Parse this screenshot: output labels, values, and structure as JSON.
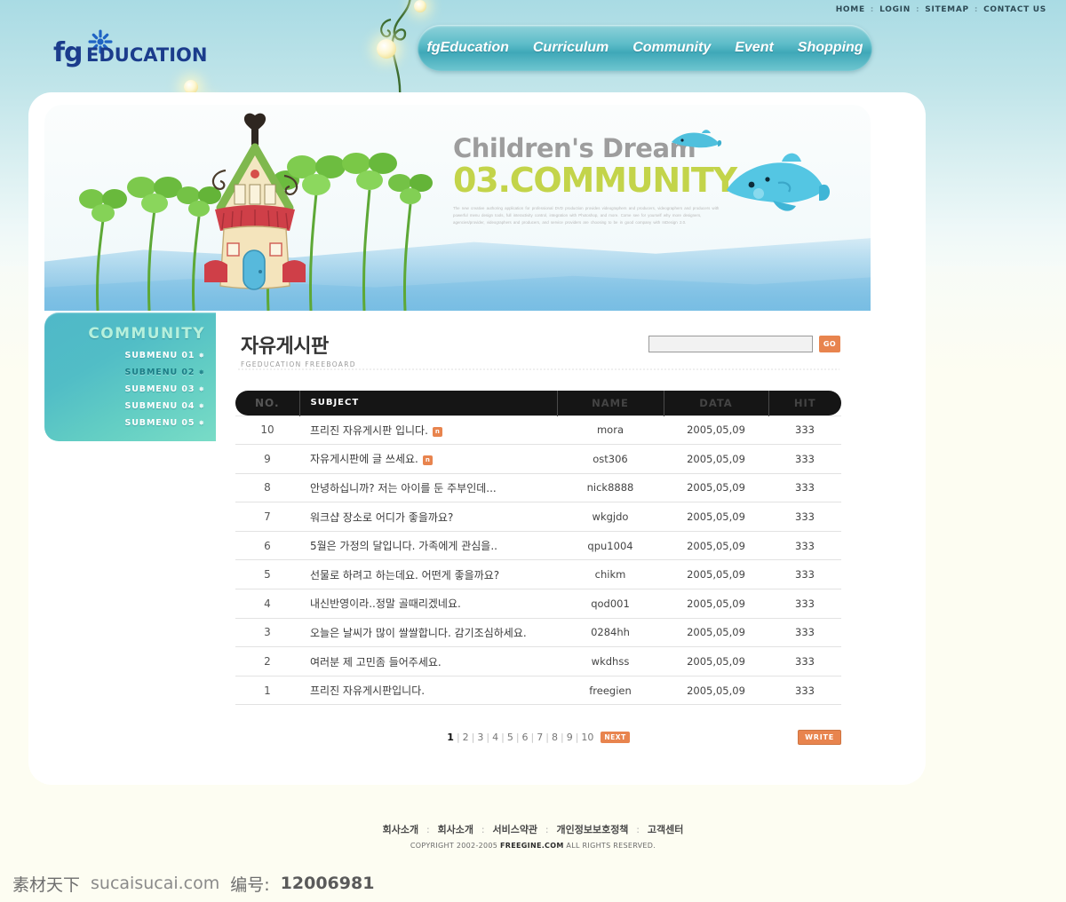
{
  "topnav": {
    "items": [
      {
        "label": "HOME"
      },
      {
        "label": "LOGIN"
      },
      {
        "label": "SITEMAP"
      },
      {
        "label": "CONTACT US"
      }
    ],
    "separator": ":"
  },
  "logo": {
    "fg": "fg",
    "edu": "EDUCATION",
    "flower_icon": "flower-icon"
  },
  "mainnav": {
    "items": [
      {
        "label": "fgEducation"
      },
      {
        "label": "Curriculum"
      },
      {
        "label": "Community"
      },
      {
        "label": "Event"
      },
      {
        "label": "Shopping"
      }
    ]
  },
  "banner": {
    "heading": "Children's Dream",
    "subheading": "03.COMMUNITY",
    "lorem": "The new creative authoring application for professional DVD production provides videographers and producers, videographers and producers with powerful menu design tools, full interactivity control, integration with Photoshop, and more. Come see for yourself why more designers, agencies/provider, videographers and producers, and service providers are choosing to be in good company with InDesign 2.0.",
    "dolphin_icon": "dolphin-icon",
    "house_icon": "fairytale-house-icon"
  },
  "sidebar": {
    "title": "COMMUNITY",
    "items": [
      {
        "label": "SUBMENU 01",
        "active": false
      },
      {
        "label": "SUBMENU 02",
        "active": true
      },
      {
        "label": "SUBMENU 03",
        "active": false
      },
      {
        "label": "SUBMENU 04",
        "active": false
      },
      {
        "label": "SUBMENU 05",
        "active": false
      }
    ],
    "bullet": "✸"
  },
  "board": {
    "title_kr": "자유게시판",
    "title_en": "FGEDUCATION FREEBOARD",
    "search": {
      "value": "",
      "placeholder": "",
      "button_label": "GO"
    },
    "columns": [
      "NO.",
      "SUBJECT",
      "NAME",
      "DATA",
      "HIT"
    ],
    "rows": [
      {
        "no": "10",
        "subject": "프리진 자유게시판 입니다.",
        "new": true,
        "name": "mora",
        "date": "2005,05,09",
        "hit": "333"
      },
      {
        "no": "9",
        "subject": "자유게시판에 글 쓰세요.",
        "new": true,
        "name": "ost306",
        "date": "2005,05,09",
        "hit": "333"
      },
      {
        "no": "8",
        "subject": "안녕하십니까? 저는 아이를 둔 주부인데...",
        "new": false,
        "name": "nick8888",
        "date": "2005,05,09",
        "hit": "333"
      },
      {
        "no": "7",
        "subject": "워크샵 장소로 어디가 좋을까요?",
        "new": false,
        "name": "wkgjdo",
        "date": "2005,05,09",
        "hit": "333"
      },
      {
        "no": "6",
        "subject": "5월은 가정의 달입니다. 가족에게 관심을..",
        "new": false,
        "name": "qpu1004",
        "date": "2005,05,09",
        "hit": "333"
      },
      {
        "no": "5",
        "subject": "선물로 하려고 하는데요. 어떤게 좋을까요?",
        "new": false,
        "name": "chikm",
        "date": "2005,05,09",
        "hit": "333"
      },
      {
        "no": "4",
        "subject": "내신반영이라..정말 골때리겠네요.",
        "new": false,
        "name": "qod001",
        "date": "2005,05,09",
        "hit": "333"
      },
      {
        "no": "3",
        "subject": "오늘은 날씨가 많이 쌀쌀합니다. 감기조심하세요.",
        "new": false,
        "name": "0284hh",
        "date": "2005,05,09",
        "hit": "333"
      },
      {
        "no": "2",
        "subject": "여러분 제 고민좀 들어주세요.",
        "new": false,
        "name": "wkdhss",
        "date": "2005,05,09",
        "hit": "333"
      },
      {
        "no": "1",
        "subject": "프리진 자유게시판입니다.",
        "new": false,
        "name": "freegien",
        "date": "2005,05,09",
        "hit": "333"
      }
    ],
    "badge_new": "n",
    "pagination": {
      "pages": [
        "1",
        "2",
        "3",
        "4",
        "5",
        "6",
        "7",
        "8",
        "9",
        "10"
      ],
      "current": "1",
      "next_label": "NEXT",
      "divider": "|"
    },
    "write_label": "WRITE"
  },
  "footer": {
    "links": [
      "회사소개",
      "회사소개",
      "서비스약관",
      "개인정보보호정책",
      "고객센터"
    ],
    "separator": ":",
    "copyright_pre": "COPYRIGHT 2002-2005 ",
    "copyright_brand": "FREEGINE.COM",
    "copyright_post": " ALL RIGHTS RESERVED."
  },
  "watermark": {
    "source": "素材天下",
    "site": "sucaisucai.com",
    "id_label": "编号:",
    "id_value": "12006981"
  },
  "colors": {
    "accent_orange": "#e8844e",
    "nav_teal": "#5cbcc8",
    "sidebar_teal": "#4fb8c8",
    "banner_green": "#c3d44a",
    "header_black": "#151515"
  }
}
